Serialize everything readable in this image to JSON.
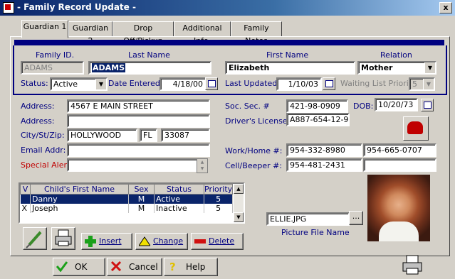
{
  "window": {
    "title": "- Family Record Update -",
    "close_label": "x"
  },
  "tabs": [
    {
      "label": "Guardian 1",
      "active": true
    },
    {
      "label": "Guardian 2",
      "active": false
    },
    {
      "label": "Drop Off/Pickup",
      "active": false
    },
    {
      "label": "Additional Info.",
      "active": false
    },
    {
      "label": "Family Notes",
      "active": false
    }
  ],
  "header": {
    "family_id_label": "Family ID.",
    "family_id_value": "ADAMS",
    "last_name_label": "Last Name",
    "last_name_value": "ADAMS",
    "first_name_label": "First Name",
    "first_name_value": "Elizabeth",
    "relation_label": "Relation",
    "relation_value": "Mother",
    "status_label": "Status:",
    "status_value": "Active",
    "date_entered_label": "Date Entered:",
    "date_entered_value": "4/18/00",
    "last_updated_label": "Last Updated:",
    "last_updated_value": "1/10/03",
    "waiting_priority_label": "Waiting List Priority:",
    "waiting_priority_value": "5"
  },
  "contact": {
    "address_label": "Address:",
    "address1": "4567 E MAIN STREET",
    "address2_label": "Address:",
    "address2": "",
    "city_label": "City/St/Zip:",
    "city": "HOLLYWOOD",
    "state": "FL",
    "zip": "33087",
    "email_label": "Email Addr:",
    "email": "",
    "special_alert_label": "Special Alert:",
    "special_alert": ""
  },
  "ids": {
    "ssn_label": "Soc. Sec. #",
    "ssn": "421-98-0909",
    "dob_label": "DOB:",
    "dob": "10/20/73",
    "license_label": "Driver's License:",
    "license": "A887-654-12-98",
    "work_home_label": "Work/Home #:",
    "work_phone": "954-332-8980",
    "home_phone": "954-665-0707",
    "cell_label": "Cell/Beeper #:",
    "cell": "954-481-2431",
    "cell2": ""
  },
  "children": {
    "columns": [
      "V",
      "Child's First Name",
      "Sex",
      "Status",
      "Priority"
    ],
    "rows": [
      {
        "v": "",
        "name": "Danny",
        "sex": "M",
        "status": "Active",
        "priority": "5"
      },
      {
        "v": "X",
        "name": "Joseph",
        "sex": "M",
        "status": "Inactive",
        "priority": "5"
      }
    ]
  },
  "picture": {
    "file": "ELLIE.JPG",
    "browse_label": "...",
    "caption": "Picture File Name"
  },
  "actions": {
    "insert": "Insert",
    "change": "Change",
    "delete": "Delete"
  },
  "dialog": {
    "ok": "OK",
    "cancel": "Cancel",
    "help": "Help"
  },
  "colors": {
    "accent": "#000080",
    "titlebar": "#0a246a",
    "alert": "#c00000",
    "face": "#d4d0c8"
  }
}
